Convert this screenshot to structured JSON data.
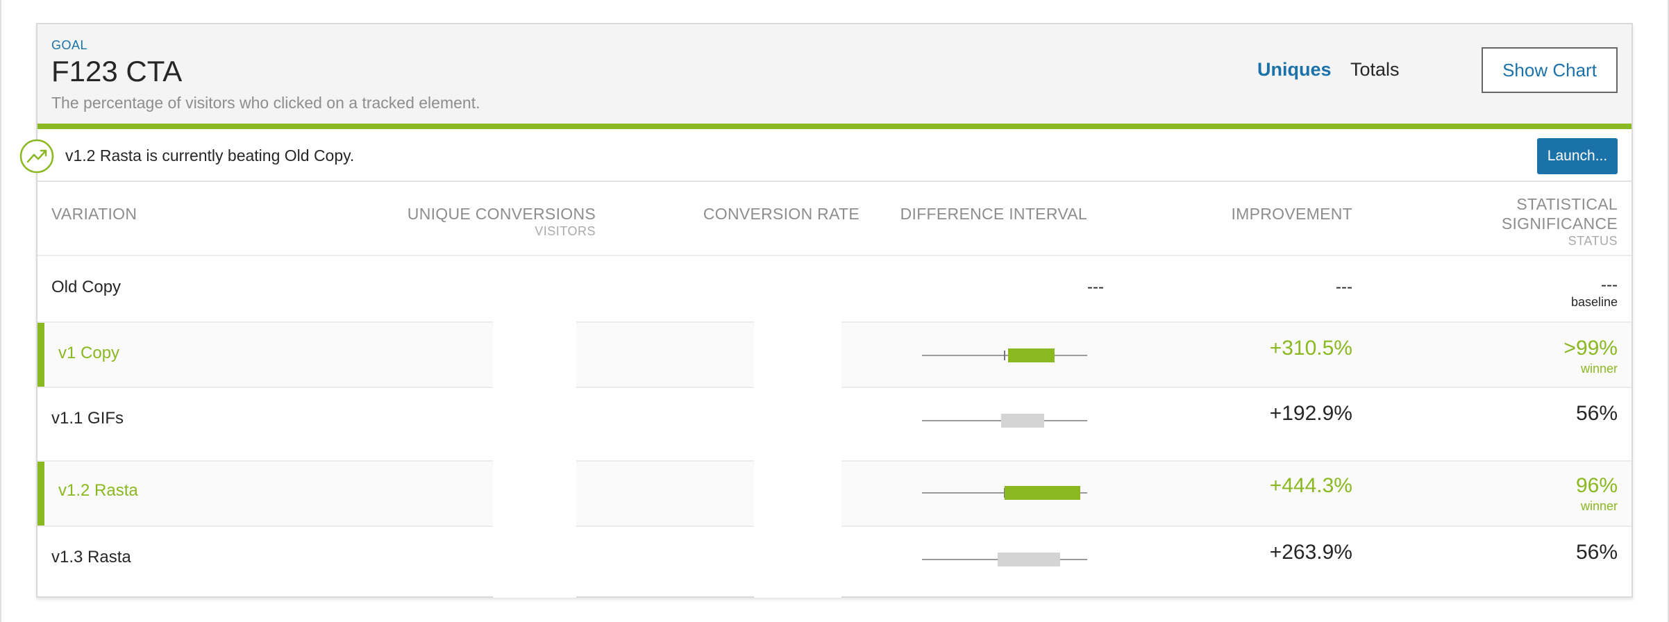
{
  "goal": {
    "label": "GOAL",
    "title": "F123 CTA",
    "description": "The percentage of visitors who clicked on a tracked element."
  },
  "tabs": [
    {
      "label": "Uniques",
      "active": true
    },
    {
      "label": "Totals",
      "active": false
    }
  ],
  "show_chart_label": "Show Chart",
  "banner": {
    "icon": "trending-up-icon",
    "text": "v1.2 Rasta is currently beating Old Copy.",
    "launch_label": "Launch..."
  },
  "columns": {
    "variation": "VARIATION",
    "unique_conversions": "UNIQUE CONVERSIONS",
    "visitors": "VISITORS",
    "conversion_rate": "CONVERSION RATE",
    "difference_interval": "DIFFERENCE INTERVAL",
    "improvement": "IMPROVEMENT",
    "stat_sig_line1": "STATISTICAL",
    "stat_sig_line2": "SIGNIFICANCE",
    "status": "STATUS"
  },
  "rows": [
    {
      "name": "Old Copy",
      "difference": "---",
      "improvement": "---",
      "significance": "---",
      "status": "baseline",
      "winner": false
    },
    {
      "name": "v1 Copy",
      "improvement": "+310.5%",
      "significance": ">99%",
      "status": "winner",
      "winner": true
    },
    {
      "name": "v1.1 GIFs",
      "improvement": "+192.9%",
      "significance": "56%",
      "status": "",
      "winner": false
    },
    {
      "name": "v1.2 Rasta",
      "improvement": "+444.3%",
      "significance": "96%",
      "status": "winner",
      "winner": true
    },
    {
      "name": "v1.3 Rasta",
      "improvement": "+263.9%",
      "significance": "56%",
      "status": "",
      "winner": false
    }
  ],
  "intervals": [
    {
      "row": 1,
      "low": 0.52,
      "high": 0.8,
      "color": "#8ab821"
    },
    {
      "row": 2,
      "low": 0.48,
      "high": 0.74,
      "color": "#d4d4d4"
    },
    {
      "row": 3,
      "low": 0.5,
      "high": 0.96,
      "color": "#8ab821"
    },
    {
      "row": 4,
      "low": 0.46,
      "high": 0.84,
      "color": "#d4d4d4"
    }
  ],
  "colors": {
    "accent_green": "#8ab821",
    "brand_blue": "#1a72a8",
    "muted_gray": "#8d8d8d"
  }
}
